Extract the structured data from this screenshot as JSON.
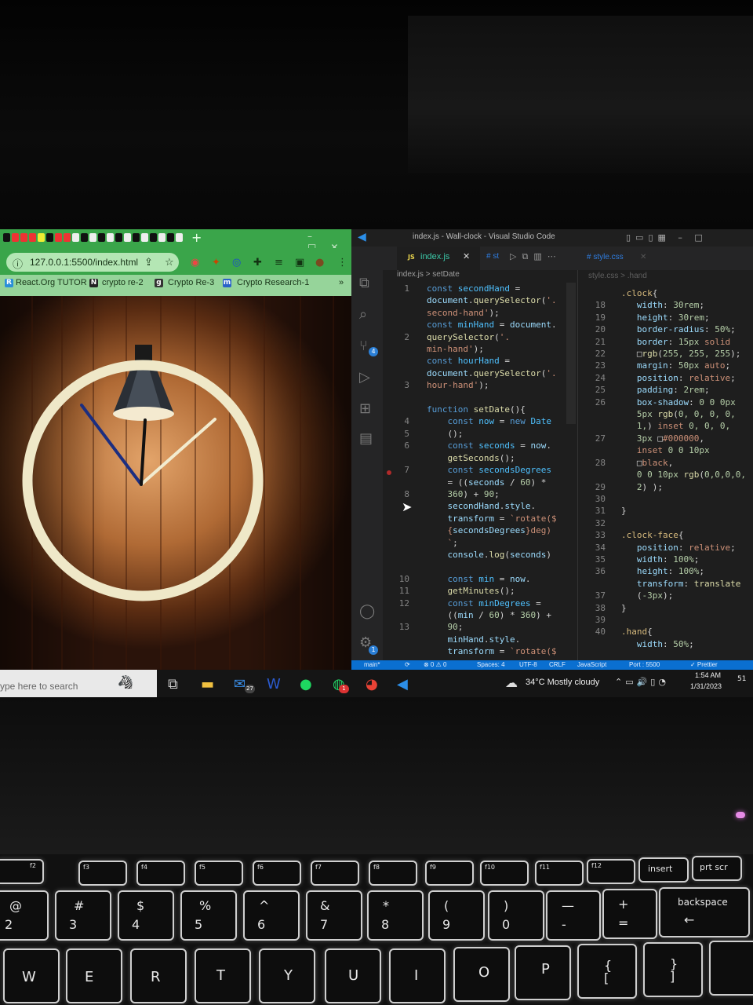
{
  "browser": {
    "url": "127.0.0.1:5500/index.html",
    "new_tab": "+",
    "bookmarks": [
      {
        "label": "React.Org TUTOR",
        "icon": "R"
      },
      {
        "label": "crypto re-2",
        "icon": "N"
      },
      {
        "label": "Crypto Re-3",
        "icon": "g"
      },
      {
        "label": "Crypto Research-1",
        "icon": "m"
      }
    ],
    "bookmarks_more": "»"
  },
  "clock_page": {
    "face_color": "#efe8c8",
    "hour_hand_color": "#1c2e80",
    "minute_hand_color": "#f2ecd0",
    "second_hand_color": "#111111"
  },
  "vscode": {
    "title": "index.js - Wall-clock - Visual Studio Code",
    "tabs": [
      {
        "label": "index.js",
        "icon": "JS"
      },
      {
        "label": "st",
        "icon": "#"
      },
      {
        "label": "style.css",
        "icon": "#"
      }
    ],
    "breadcrumb_left": "index.js  >  setDate",
    "breadcrumb_right": "style.css  >  .hand",
    "status": {
      "branch": "main*",
      "problems": "⊗ 0 ⚠ 0",
      "spaces": "Spaces: 4",
      "encoding": "UTF-8",
      "eol": "CRLF",
      "language": "JavaScript",
      "port": "Port : 5500",
      "formatter": "✓ Prettier"
    },
    "badges": {
      "source_control": "4",
      "settings": "1"
    }
  },
  "taskbar": {
    "search_placeholder": "ype here to search",
    "mail_badge": "27",
    "whatsapp_badge": "1",
    "weather": "34°C  Mostly cloudy",
    "time": "1:54 AM",
    "date": "1/31/2023",
    "notification_count": "51"
  },
  "keyboard": {
    "fkeys": [
      "f2",
      "f3",
      "f4",
      "f5",
      "f6",
      "f7",
      "f8",
      "f9",
      "f10",
      "f11",
      "f12",
      "insert",
      "prt scr"
    ],
    "numbers": [
      {
        "top": "@",
        "bottom": "2"
      },
      {
        "top": "#",
        "bottom": "3"
      },
      {
        "top": "$",
        "bottom": "4"
      },
      {
        "top": "%",
        "bottom": "5"
      },
      {
        "top": "^",
        "bottom": "6"
      },
      {
        "top": "&",
        "bottom": "7"
      },
      {
        "top": "*",
        "bottom": "8"
      },
      {
        "top": "(",
        "bottom": "9"
      },
      {
        "top": ")",
        "bottom": "0"
      },
      {
        "top": "—",
        "bottom": "-"
      },
      {
        "top": "+",
        "bottom": "="
      },
      {
        "top": "backspace",
        "bottom": "←"
      }
    ],
    "letters": [
      "W",
      "E",
      "R",
      "T",
      "Y",
      "U",
      "I",
      "O",
      "P",
      "{ [",
      "} ]"
    ]
  }
}
